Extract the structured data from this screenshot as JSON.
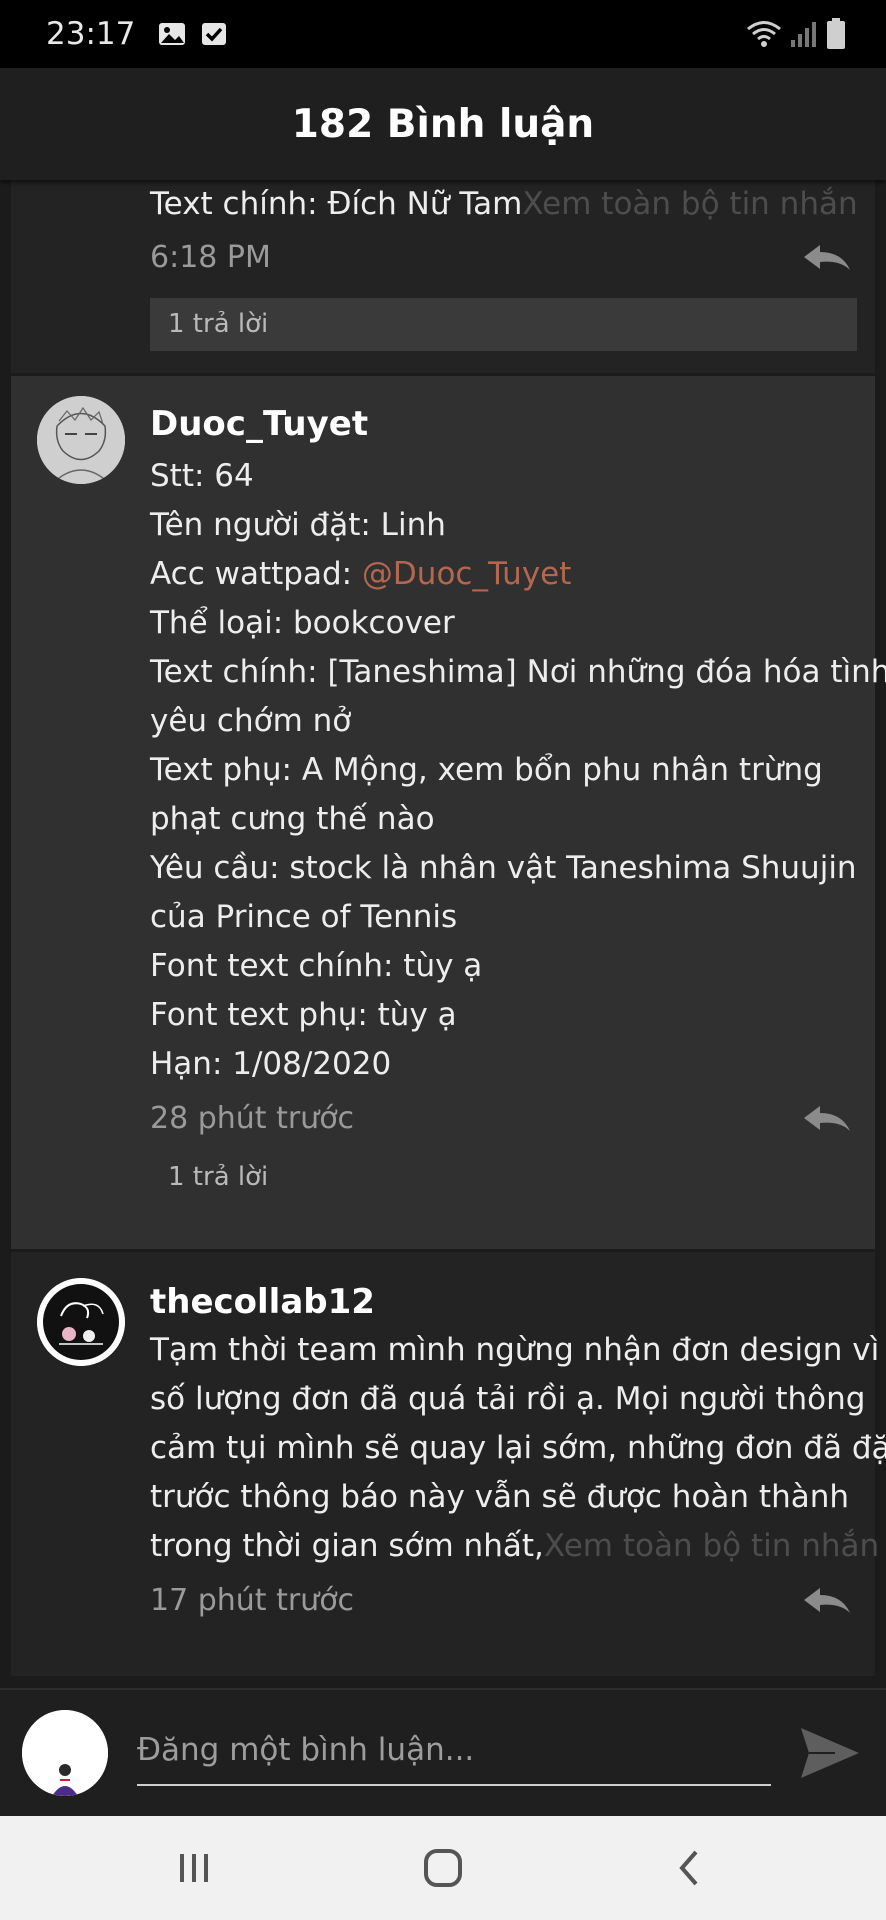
{
  "status_bar": {
    "time": "23:17",
    "left_icons": [
      "image-icon",
      "checkbox-icon"
    ],
    "right_icons": [
      "wifi-icon",
      "signal-icon",
      "battery-icon"
    ]
  },
  "header": {
    "title": "182 Bình luận"
  },
  "comments": [
    {
      "lines": [
        "Text chính: Đích Nữ Tam"
      ],
      "more_label": "Xem toàn bộ tin nhắn",
      "time": "6:18 PM",
      "replies": "1 trả lời"
    },
    {
      "author": "Duoc_Tuyet",
      "lines": [
        "Stt: 64",
        "Tên người đặt: Linh",
        "Acc wattpad: ",
        "Thể loại: bookcover",
        "Text chính: [Taneshima] Nơi những đóa hóa tình",
        "yêu chớm nở",
        "Text phụ: A Mộng, xem bổn phu nhân trừng",
        "phạt cưng thế nào",
        "Yêu cầu: stock là nhân vật Taneshima Shuujin",
        "của Prince of Tennis",
        "Font text chính: tùy ạ",
        "Font text phụ: tùy ạ",
        "Hạn: 1/08/2020"
      ],
      "mention": "@Duoc_Tuyet",
      "time": "28 phút trước",
      "replies": "1 trả lời"
    },
    {
      "author": "thecollab12",
      "lines": [
        "Tạm thời team mình ngừng nhận đơn design vì",
        "số lượng đơn đã quá tải rồi ạ. Mọi người thông",
        "cảm tụi mình sẽ quay lại sớm, những đơn đã đặt",
        "trước thông báo này vẫn sẽ được hoàn thành",
        "trong thời gian sớm nhất,"
      ],
      "more_label": "Xem toàn bộ tin nhắn",
      "time": "17 phút trước"
    }
  ],
  "composer": {
    "placeholder": "Đăng một bình luận..."
  },
  "navbar": {
    "buttons": [
      "recent-apps-icon",
      "home-icon",
      "back-icon"
    ]
  },
  "colors": {
    "mention": "#b4664f",
    "background": "#1b1b1b",
    "highlight": "#303030"
  }
}
